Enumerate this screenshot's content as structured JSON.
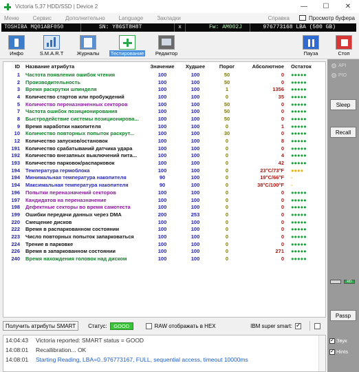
{
  "window": {
    "title": "Victoria 5.37 HDD/SSD | Device 2",
    "minimize": "—",
    "maximize": "☐",
    "close": "✕"
  },
  "menu": {
    "items": [
      "Меню",
      "Сервис",
      "Дополнительно",
      "Language",
      "Закладки"
    ],
    "help": "Справка",
    "viewer": "Просмотр буфера"
  },
  "drive": {
    "model": "TOSHIBA MQ01ABF050",
    "sn": "SN: Y86ST8H8T",
    "x": "x",
    "fw": "Fw: AM002J",
    "lba": "976773168 LBA (500 GB)"
  },
  "toolbar": {
    "info": "Инфо",
    "smart": "S.M.A.R.T",
    "journals": "Журналы",
    "testing": "Тестирование",
    "editor": "Редактор",
    "pause": "Пауза",
    "stop": "Стоп"
  },
  "table": {
    "headers": {
      "id": "ID",
      "name": "Название атрибута",
      "value": "Значение",
      "worst": "Худшее",
      "threshold": "Порог",
      "raw": "Абсолютное",
      "status": "Остаток"
    },
    "rows": [
      {
        "id": "1",
        "name": "Частота появления ошибок чтения",
        "value": "100",
        "worst": "100",
        "threshold": "50",
        "raw": "0",
        "status": "●●●●●",
        "color": "green"
      },
      {
        "id": "2",
        "name": "Производительность",
        "value": "100",
        "worst": "100",
        "threshold": "50",
        "raw": "0",
        "status": "●●●●●",
        "color": "green"
      },
      {
        "id": "3",
        "name": "Время раскрутки шпинделя",
        "value": "100",
        "worst": "100",
        "threshold": "1",
        "raw": "1356",
        "status": "●●●●●",
        "color": "green"
      },
      {
        "id": "4",
        "name": "Количество стартов или пробуждений",
        "value": "100",
        "worst": "100",
        "threshold": "0",
        "raw": "35",
        "status": "●●●●●",
        "color": "black"
      },
      {
        "id": "5",
        "name": "Количество переназначенных секторов",
        "value": "100",
        "worst": "100",
        "threshold": "50",
        "raw": "0",
        "status": "●●●●●",
        "color": "purple"
      },
      {
        "id": "7",
        "name": "Частота ошибок позиционирования",
        "value": "100",
        "worst": "100",
        "threshold": "50",
        "raw": "0",
        "status": "●●●●●",
        "color": "green"
      },
      {
        "id": "8",
        "name": "Быстродействие системы позиционирова...",
        "value": "100",
        "worst": "100",
        "threshold": "50",
        "raw": "0",
        "status": "●●●●●",
        "color": "green"
      },
      {
        "id": "9",
        "name": "Время наработки накопителя",
        "value": "100",
        "worst": "100",
        "threshold": "0",
        "raw": "1",
        "status": "●●●●●",
        "color": "black"
      },
      {
        "id": "10",
        "name": "Количество повторных попыток раскрут...",
        "value": "100",
        "worst": "100",
        "threshold": "30",
        "raw": "0",
        "status": "●●●●●",
        "color": "green"
      },
      {
        "id": "12",
        "name": "Количество запусков/остановок",
        "value": "100",
        "worst": "100",
        "threshold": "0",
        "raw": "8",
        "status": "●●●●●",
        "color": "black"
      },
      {
        "id": "191",
        "name": "Количество срабатываний датчика удара",
        "value": "100",
        "worst": "100",
        "threshold": "0",
        "raw": "0",
        "status": "●●●●●",
        "color": "black"
      },
      {
        "id": "192",
        "name": "Количество внезапных выключений пита...",
        "value": "100",
        "worst": "100",
        "threshold": "0",
        "raw": "4",
        "status": "●●●●●",
        "color": "black"
      },
      {
        "id": "193",
        "name": "Количество парковок/распарковок",
        "value": "100",
        "worst": "100",
        "threshold": "0",
        "raw": "42",
        "status": "●●●●●",
        "color": "black"
      },
      {
        "id": "194",
        "name": "Температура гермоблока",
        "value": "100",
        "worst": "100",
        "threshold": "0",
        "raw": "23°C/73°F",
        "status": "●●●●",
        "color": "blue",
        "temp": true,
        "warn": true
      },
      {
        "id": "194",
        "name": "Минимальная температура накопителя",
        "value": "90",
        "worst": "100",
        "threshold": "0",
        "raw": "19°C/66°F",
        "status": "-",
        "color": "blue",
        "temp": true,
        "dash": true
      },
      {
        "id": "194",
        "name": "Максимальная температура накопителя",
        "value": "90",
        "worst": "100",
        "threshold": "0",
        "raw": "38°C/100°F",
        "status": "-",
        "color": "blue",
        "temp": true,
        "dash": true
      },
      {
        "id": "196",
        "name": "Попытки переназначений секторов",
        "value": "100",
        "worst": "100",
        "threshold": "0",
        "raw": "0",
        "status": "●●●●●",
        "color": "purple"
      },
      {
        "id": "197",
        "name": "Кандидатов на переназначение",
        "value": "100",
        "worst": "100",
        "threshold": "0",
        "raw": "0",
        "status": "●●●●●",
        "color": "purple"
      },
      {
        "id": "198",
        "name": "Дефектные секторы во время самотеста",
        "value": "100",
        "worst": "100",
        "threshold": "0",
        "raw": "0",
        "status": "●●●●●",
        "color": "purple"
      },
      {
        "id": "199",
        "name": "Ошибки передачи данных через DMA",
        "value": "200",
        "worst": "253",
        "threshold": "0",
        "raw": "0",
        "status": "●●●●●",
        "color": "black"
      },
      {
        "id": "220",
        "name": "Смещение дисков",
        "value": "100",
        "worst": "100",
        "threshold": "0",
        "raw": "0",
        "status": "●●●●●",
        "color": "black"
      },
      {
        "id": "222",
        "name": "Время в распаркованном состоянии",
        "value": "100",
        "worst": "100",
        "threshold": "0",
        "raw": "0",
        "status": "●●●●●",
        "color": "black"
      },
      {
        "id": "223",
        "name": "Число повторных попыток запарковаться",
        "value": "100",
        "worst": "100",
        "threshold": "0",
        "raw": "0",
        "status": "●●●●●",
        "color": "black"
      },
      {
        "id": "224",
        "name": "Трение в парковке",
        "value": "100",
        "worst": "100",
        "threshold": "0",
        "raw": "0",
        "status": "●●●●●",
        "color": "black"
      },
      {
        "id": "226",
        "name": "Время в запаркованном состоянии",
        "value": "100",
        "worst": "100",
        "threshold": "0",
        "raw": "271",
        "status": "●●●●●",
        "color": "black"
      },
      {
        "id": "240",
        "name": "Время нахождения головок над диском",
        "value": "100",
        "worst": "100",
        "threshold": "0",
        "raw": "0",
        "status": "●●●●●",
        "color": "green"
      }
    ]
  },
  "side": {
    "api": "API",
    "pio": "PIO",
    "sleep": "Sleep",
    "recall": "Recall",
    "passp": "Passp",
    "rd": "RD"
  },
  "bottom": {
    "get_smart": "Получить атрибуты SMART",
    "status_label": "Статус:",
    "status_value": "GOOD",
    "raw_hex": "RAW отображать в HEX",
    "ibm": "IBM super smart:"
  },
  "log": [
    {
      "time": "14:04:43",
      "msg": "Victoria reported: SMART status = GOOD",
      "style": "normal"
    },
    {
      "time": "14:08:01",
      "msg": "Recallibration... OK",
      "style": "normal"
    },
    {
      "time": "14:08:01",
      "msg": "Starting Reading, LBA=0..976773167, FULL, sequential access, timeout 10000ms",
      "style": "blue"
    }
  ],
  "sound": {
    "sound": "Звук",
    "hints": "Hints"
  },
  "colors": {
    "good": "#3ac23a",
    "accent": "#4a92e0",
    "stop": "#d63838",
    "pause": "#2f6bd1"
  }
}
